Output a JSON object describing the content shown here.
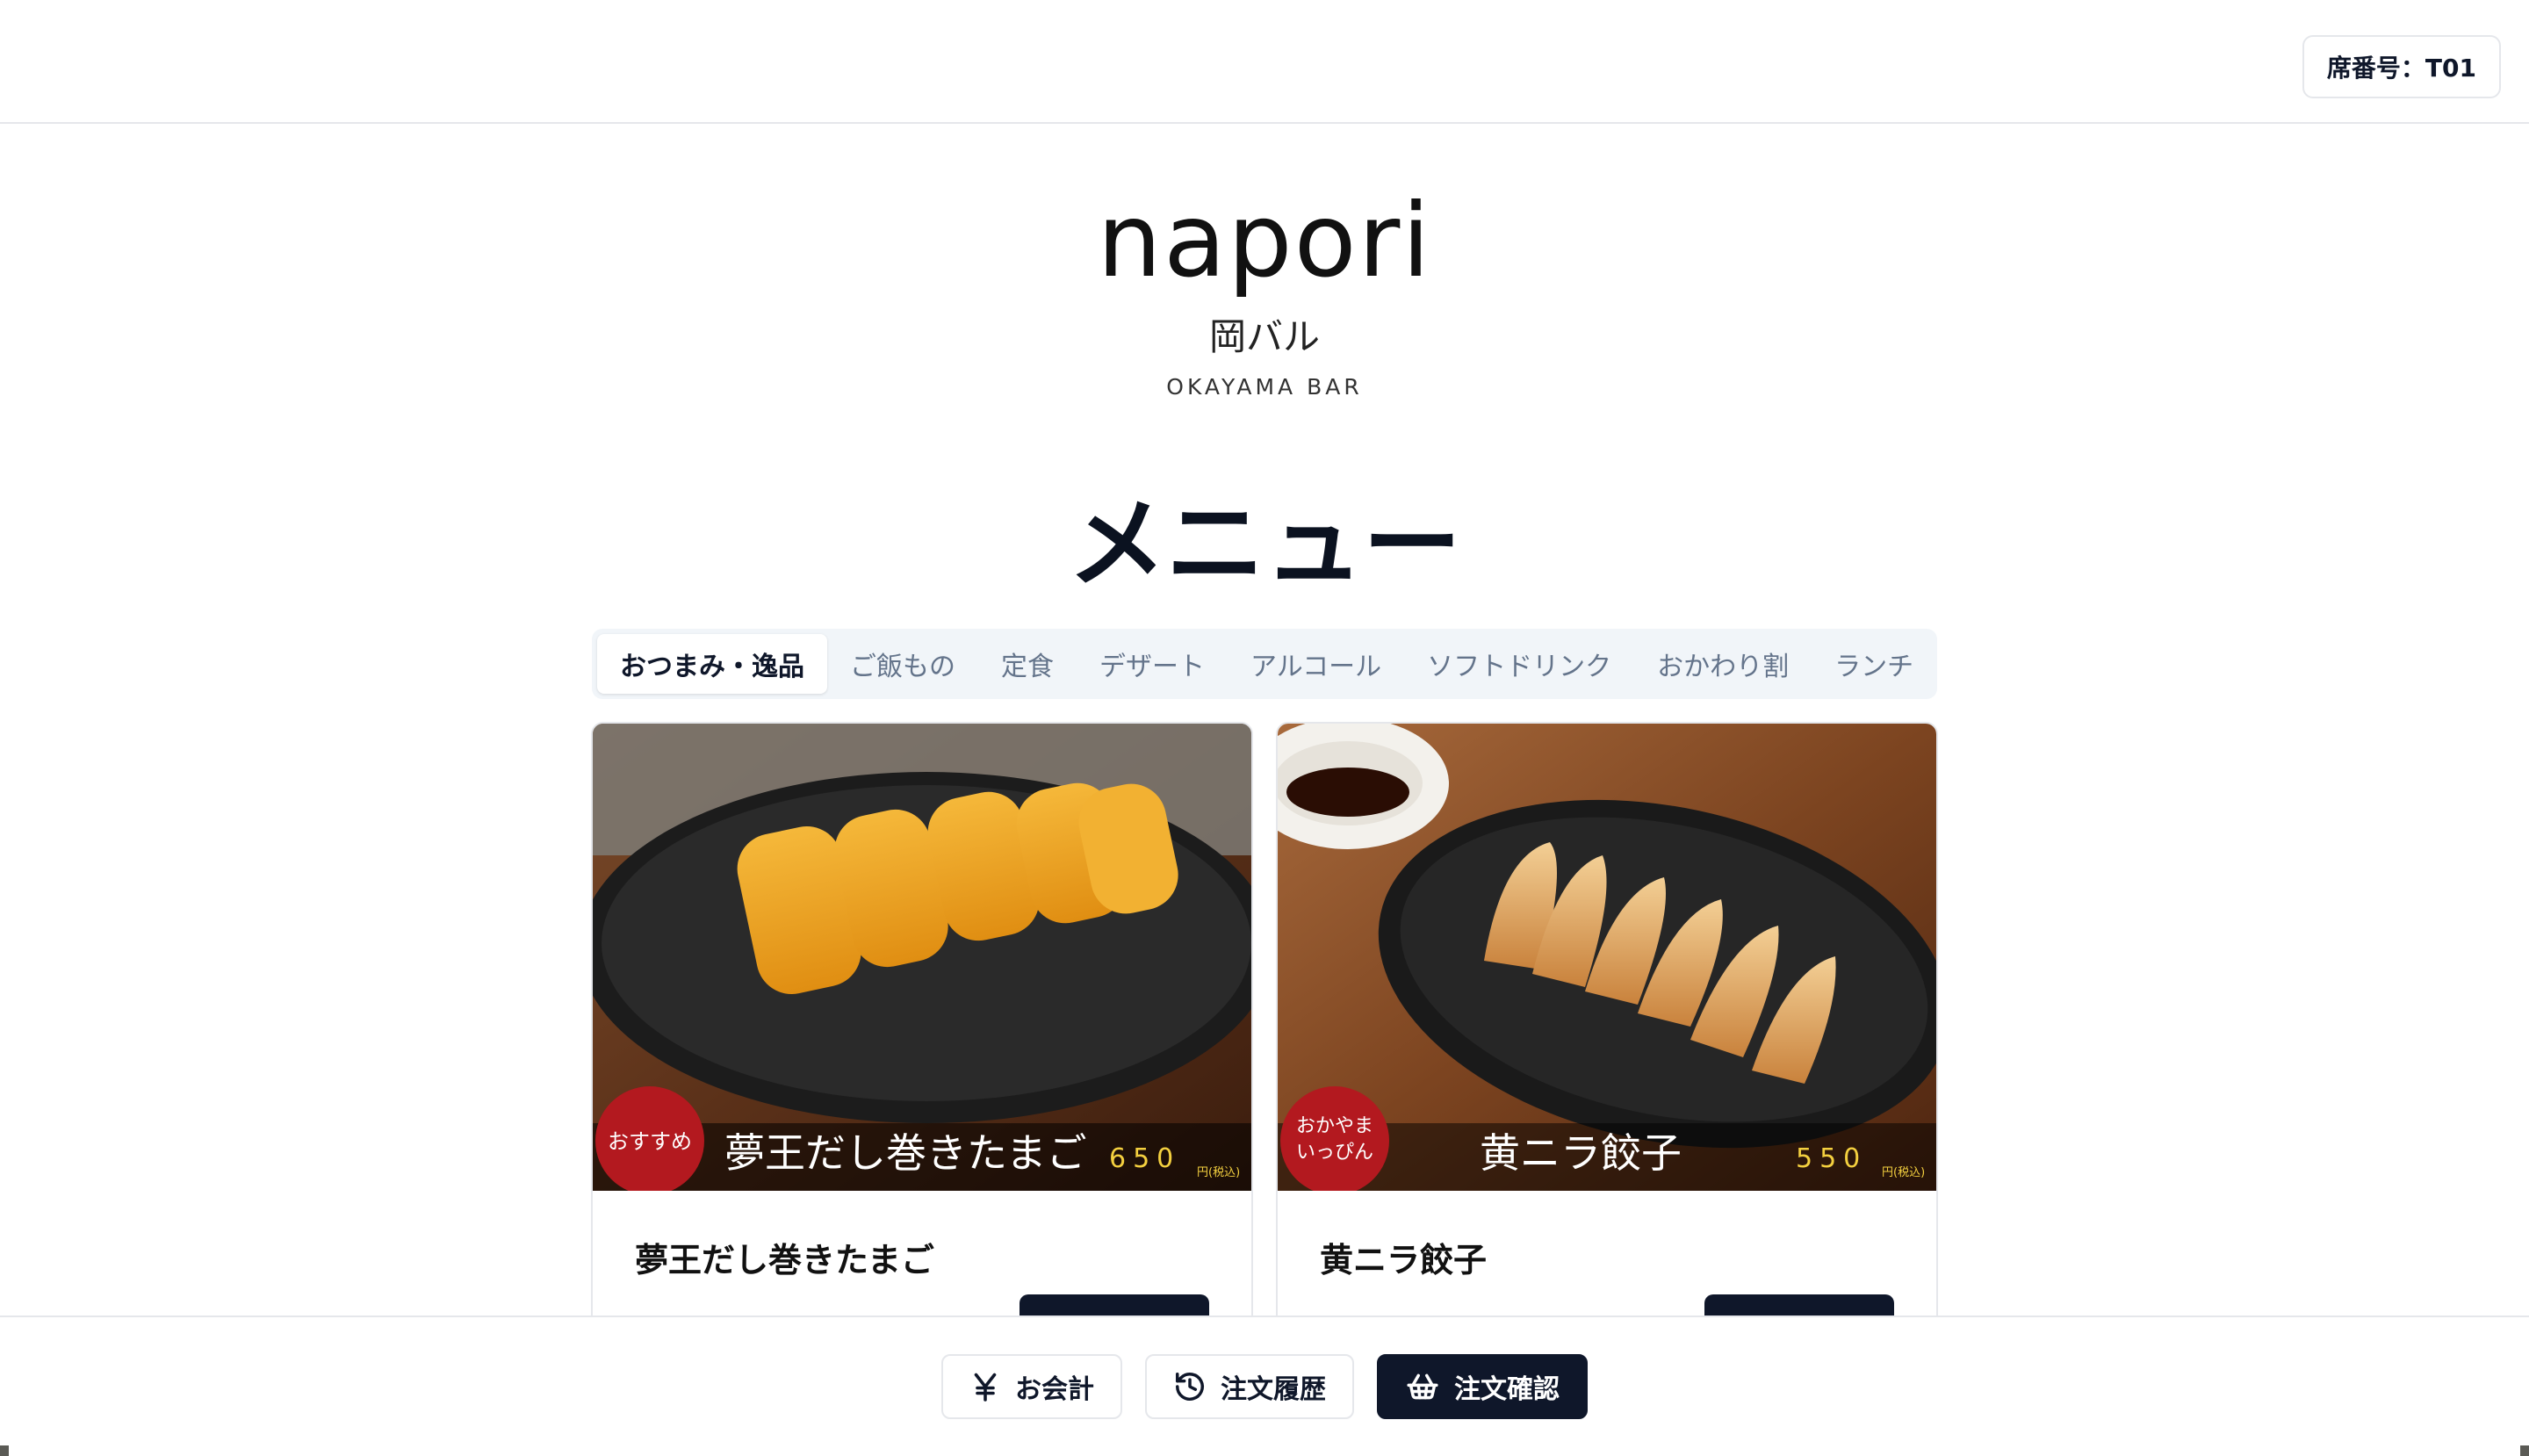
{
  "header": {
    "seat_label": "席番号：T01"
  },
  "brand": {
    "name": "napori",
    "subtitle": "岡バル",
    "english": "OKAYAMA BAR"
  },
  "menu": {
    "title": "メニュー",
    "tabs": [
      {
        "label": "おつまみ・逸品",
        "active": true
      },
      {
        "label": "ご飯もの",
        "active": false
      },
      {
        "label": "定食",
        "active": false
      },
      {
        "label": "デザート",
        "active": false
      },
      {
        "label": "アルコール",
        "active": false
      },
      {
        "label": "ソフトドリンク",
        "active": false
      },
      {
        "label": "おかわり割",
        "active": false
      },
      {
        "label": "ランチ",
        "active": false
      }
    ],
    "items": [
      {
        "name": "夢王だし巻きたまご",
        "photo_badge": "おすすめ",
        "photo_title": "夢王だし巻きたまご",
        "photo_price": "650",
        "photo_tax": "円(税込)"
      },
      {
        "name": "黄ニラ餃子",
        "photo_badge_line1": "おかやま",
        "photo_badge_line2": "いっぴん",
        "photo_title": "黄ニラ餃子",
        "photo_price": "550",
        "photo_tax": "円(税込)"
      }
    ]
  },
  "footer": {
    "checkout_label": "お会計",
    "history_label": "注文履歴",
    "confirm_label": "注文確認"
  },
  "colors": {
    "primary": "#0f172a",
    "badge_red": "#b3191f",
    "price_yellow": "#f4d03f"
  }
}
